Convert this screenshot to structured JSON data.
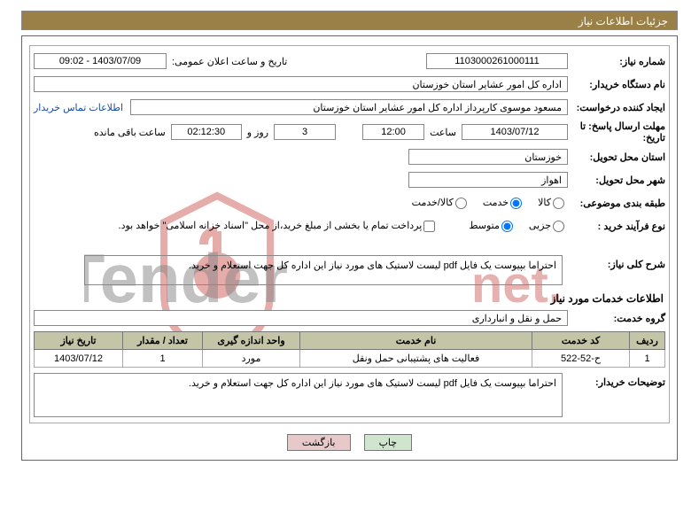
{
  "title": "جزئیات اطلاعات نیاز",
  "fields": {
    "need_no_label": "شماره نیاز:",
    "need_no": "1103000261000111",
    "pub_dt_label": "تاریخ و ساعت اعلان عمومی:",
    "pub_dt": "1403/07/09 - 09:02",
    "buyer_org_label": "نام دستگاه خریدار:",
    "buyer_org": "اداره کل امور عشایر استان خوزستان",
    "requester_label": "ایجاد کننده درخواست:",
    "requester": "مسعود موسوی کارپرداز اداره کل امور عشایر استان خوزستان",
    "contact_link": "اطلاعات تماس خریدار",
    "deadline_label": "مهلت ارسال پاسخ: تا تاریخ:",
    "deadline_date": "1403/07/12",
    "time_word": "ساعت",
    "deadline_time": "12:00",
    "days": "3",
    "days_suffix": "روز و",
    "countdown": "02:12:30",
    "remain_suffix": "ساعت باقی مانده",
    "delivery_province_label": "استان محل تحویل:",
    "delivery_province": "خوزستان",
    "delivery_city_label": "شهر محل تحویل:",
    "delivery_city": "اهواز",
    "subject_class_label": "طبقه بندی موضوعی:",
    "radio_kala": "کالا",
    "radio_service": "خدمت",
    "radio_kala_service": "کالا/خدمت",
    "purchase_type_label": "نوع فرآیند خرید :",
    "radio_minor": "جزیی",
    "radio_medium": "متوسط",
    "payment_note": "پرداخت تمام یا بخشی از مبلغ خرید،از محل \"اسناد خزانه اسلامی\" خواهد بود.",
    "overall_desc_label": "شرح کلی نیاز:",
    "overall_desc": "احتراما بپیوست یک فایل pdf لیست لاستیک های مورد نیاز این اداره کل جهت استعلام و خرید.",
    "services_info_title": "اطلاعات خدمات مورد نیاز",
    "service_group_label": "گروه خدمت:",
    "service_group": "حمل و نقل و انبارداری",
    "buyer_notes_label": "توضیحات خریدار:",
    "buyer_notes": "احتراما بپیوست یک فایل pdf لیست لاستیک های مورد نیاز این اداره کل جهت استعلام و خرید."
  },
  "table": {
    "headers": {
      "row": "ردیف",
      "code": "کد خدمت",
      "name": "نام خدمت",
      "unit": "واحد اندازه گیری",
      "qty": "تعداد / مقدار",
      "date": "تاریخ نیاز"
    },
    "rows": [
      {
        "row": "1",
        "code": "ح-52-522",
        "name": "فعالیت های پشتیبانی حمل ونقل",
        "unit": "مورد",
        "qty": "1",
        "date": "1403/07/12"
      }
    ]
  },
  "buttons": {
    "print": "چاپ",
    "back": "بازگشت"
  },
  "watermark": {
    "text": "AriaTender.net"
  }
}
